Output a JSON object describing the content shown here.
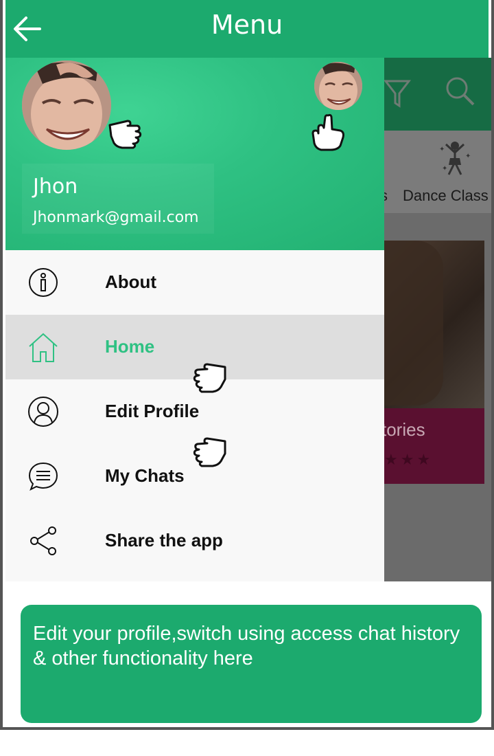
{
  "header": {
    "title": "Menu",
    "back_icon": "arrow-left-icon"
  },
  "user": {
    "name": "Jhon",
    "email": "Jhonmark@gmail.com"
  },
  "menu": {
    "items": [
      {
        "label": "About",
        "icon": "info-icon",
        "active": false
      },
      {
        "label": "Home",
        "icon": "home-icon",
        "active": true
      },
      {
        "label": "Edit Profile",
        "icon": "user-icon",
        "active": false
      },
      {
        "label": "My Chats",
        "icon": "chat-icon",
        "active": false
      },
      {
        "label": "Share the app",
        "icon": "share-icon",
        "active": false
      }
    ]
  },
  "background_app": {
    "category_suffix": "s",
    "category_label": "Dance Class",
    "card_text": "tories"
  },
  "caption": {
    "text": "Edit your profile,switch using access chat history & other functionality here"
  },
  "colors": {
    "primary": "#1caa6e",
    "accent": "#2fc183",
    "active_bg": "#dedede"
  }
}
